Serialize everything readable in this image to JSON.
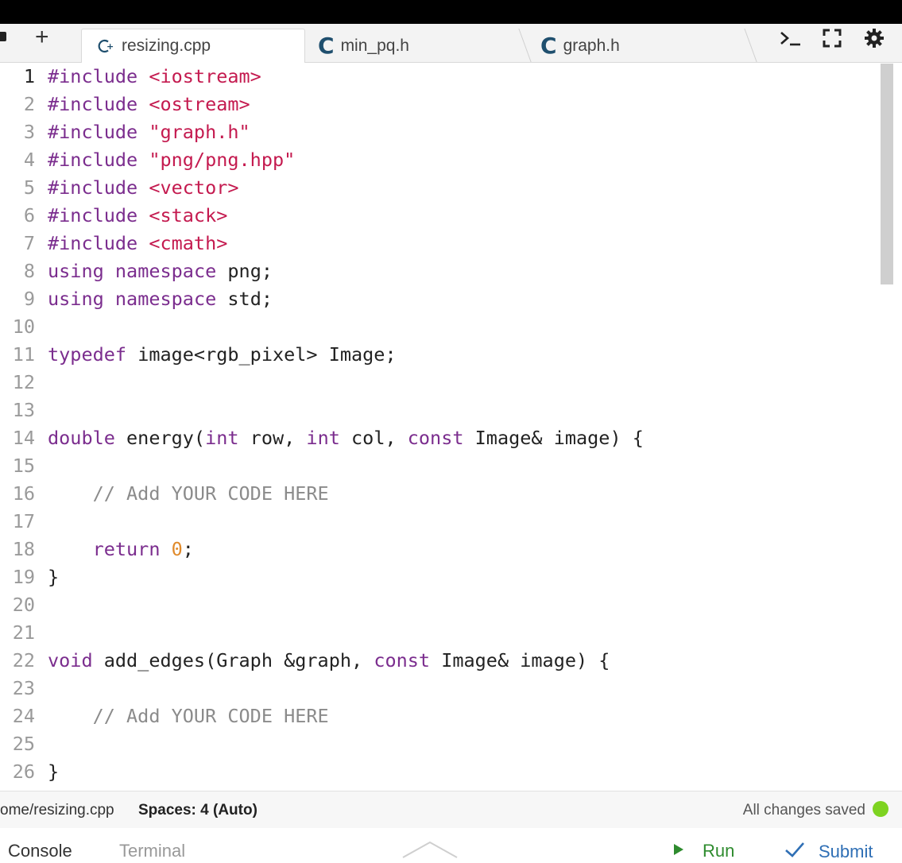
{
  "tabs": [
    {
      "label": "resizing.cpp",
      "icon": "cpp-file-icon",
      "active": true
    },
    {
      "label": "min_pq.h",
      "icon": "c-file-icon",
      "active": false
    },
    {
      "label": "graph.h",
      "icon": "c-file-icon",
      "active": false
    }
  ],
  "toolbar": {
    "add_tab_glyph": "+",
    "terminal_icon": "terminal-icon",
    "fullscreen_icon": "fullscreen-icon",
    "settings_icon": "gear-icon"
  },
  "colors": {
    "keyword": "#7b2d8e",
    "string": "#c41a4f",
    "comment": "#8b8b8b",
    "number": "#e08a2b",
    "saved_dot": "#7ed321",
    "run": "#2e8b2e",
    "submit": "#2f6fb5"
  },
  "code_lines": [
    {
      "n": "1",
      "tokens": [
        [
          "k",
          "#include"
        ],
        [
          "p",
          " "
        ],
        [
          "s",
          "<iostream>"
        ]
      ]
    },
    {
      "n": "2",
      "tokens": [
        [
          "k",
          "#include"
        ],
        [
          "p",
          " "
        ],
        [
          "s",
          "<ostream>"
        ]
      ]
    },
    {
      "n": "3",
      "tokens": [
        [
          "k",
          "#include"
        ],
        [
          "p",
          " "
        ],
        [
          "s",
          "\"graph.h\""
        ]
      ]
    },
    {
      "n": "4",
      "tokens": [
        [
          "k",
          "#include"
        ],
        [
          "p",
          " "
        ],
        [
          "s",
          "\"png/png.hpp\""
        ]
      ]
    },
    {
      "n": "5",
      "tokens": [
        [
          "k",
          "#include"
        ],
        [
          "p",
          " "
        ],
        [
          "s",
          "<vector>"
        ]
      ]
    },
    {
      "n": "6",
      "tokens": [
        [
          "k",
          "#include"
        ],
        [
          "p",
          " "
        ],
        [
          "s",
          "<stack>"
        ]
      ]
    },
    {
      "n": "7",
      "tokens": [
        [
          "k",
          "#include"
        ],
        [
          "p",
          " "
        ],
        [
          "s",
          "<cmath>"
        ]
      ]
    },
    {
      "n": "8",
      "tokens": [
        [
          "k",
          "using"
        ],
        [
          "p",
          " "
        ],
        [
          "k",
          "namespace"
        ],
        [
          "p",
          " png;"
        ]
      ]
    },
    {
      "n": "9",
      "tokens": [
        [
          "k",
          "using"
        ],
        [
          "p",
          " "
        ],
        [
          "k",
          "namespace"
        ],
        [
          "p",
          " std;"
        ]
      ]
    },
    {
      "n": "10",
      "tokens": []
    },
    {
      "n": "11",
      "tokens": [
        [
          "k",
          "typedef"
        ],
        [
          "p",
          " image<rgb_pixel> Image;"
        ]
      ]
    },
    {
      "n": "12",
      "tokens": []
    },
    {
      "n": "13",
      "tokens": []
    },
    {
      "n": "14",
      "tokens": [
        [
          "k",
          "double"
        ],
        [
          "p",
          " energy("
        ],
        [
          "k",
          "int"
        ],
        [
          "p",
          " row, "
        ],
        [
          "k",
          "int"
        ],
        [
          "p",
          " col, "
        ],
        [
          "k",
          "const"
        ],
        [
          "p",
          " Image& image) {"
        ]
      ]
    },
    {
      "n": "15",
      "tokens": []
    },
    {
      "n": "16",
      "tokens": [
        [
          "p",
          "    "
        ],
        [
          "c",
          "// Add YOUR CODE HERE"
        ]
      ]
    },
    {
      "n": "17",
      "tokens": []
    },
    {
      "n": "18",
      "tokens": [
        [
          "p",
          "    "
        ],
        [
          "k",
          "return"
        ],
        [
          "p",
          " "
        ],
        [
          "n",
          "0"
        ],
        [
          "p",
          ";"
        ]
      ]
    },
    {
      "n": "19",
      "tokens": [
        [
          "p",
          "}"
        ]
      ]
    },
    {
      "n": "20",
      "tokens": []
    },
    {
      "n": "21",
      "tokens": []
    },
    {
      "n": "22",
      "tokens": [
        [
          "k",
          "void"
        ],
        [
          "p",
          " add_edges(Graph &graph, "
        ],
        [
          "k",
          "const"
        ],
        [
          "p",
          " Image& image) {"
        ]
      ]
    },
    {
      "n": "23",
      "tokens": []
    },
    {
      "n": "24",
      "tokens": [
        [
          "p",
          "    "
        ],
        [
          "c",
          "// Add YOUR CODE HERE"
        ]
      ]
    },
    {
      "n": "25",
      "tokens": []
    },
    {
      "n": "26",
      "tokens": [
        [
          "p",
          "}"
        ]
      ]
    }
  ],
  "status": {
    "path": "ome/resizing.cpp",
    "spaces": "Spaces: 4 (Auto)",
    "saved": "All changes saved"
  },
  "bottom": {
    "console": "Console",
    "terminal": "Terminal",
    "run": "Run",
    "submit": "Submit"
  }
}
